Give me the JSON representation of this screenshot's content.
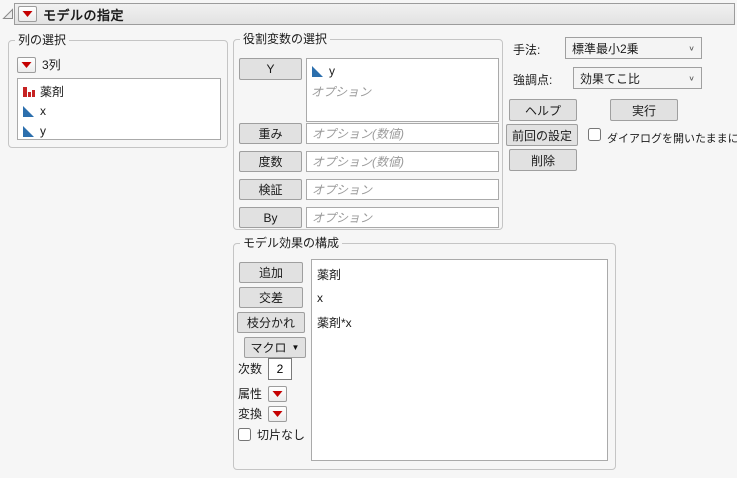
{
  "window": {
    "title": "モデルの指定"
  },
  "ui": {
    "combo_chevron": "∨",
    "menu_arrow": "▼"
  },
  "column_selection": {
    "title": "列の選択",
    "count_label": "3列",
    "columns": [
      {
        "name": "薬剤",
        "icon": "nominal-bars-icon"
      },
      {
        "name": "x",
        "icon": "continuous-triangle-icon"
      },
      {
        "name": "y",
        "icon": "continuous-triangle-icon"
      }
    ]
  },
  "role_variables": {
    "title": "役割変数の選択",
    "y": {
      "button": "Y",
      "items": [
        {
          "name": "y",
          "icon": "continuous-triangle-icon"
        }
      ],
      "placeholder": "オプション"
    },
    "weight": {
      "button": "重み",
      "placeholder": "オプション(数値)"
    },
    "freq": {
      "button": "度数",
      "placeholder": "オプション(数値)"
    },
    "validation": {
      "button": "検証",
      "placeholder": "オプション"
    },
    "by": {
      "button": "By",
      "placeholder": "オプション"
    }
  },
  "settings": {
    "method": {
      "label": "手法:",
      "value": "標準最小2乗"
    },
    "emphasis": {
      "label": "強調点:",
      "value": "効果てこ比"
    }
  },
  "actions": {
    "help": "ヘルプ",
    "run": "実行",
    "recall": "前回の設定",
    "remove": "削除",
    "keep_dialog_open": {
      "label": "ダイアログを開いたままにする",
      "checked": false
    }
  },
  "model_effects": {
    "title": "モデル効果の構成",
    "add": "追加",
    "cross": "交差",
    "nest": "枝分かれ",
    "macros": "マクロ",
    "degree": {
      "label": "次数",
      "value": "2"
    },
    "attributes_label": "属性",
    "transform_label": "変換",
    "no_intercept": {
      "label": "切片なし",
      "checked": false
    },
    "effects": [
      "薬剤",
      "x",
      "薬剤*x"
    ]
  }
}
